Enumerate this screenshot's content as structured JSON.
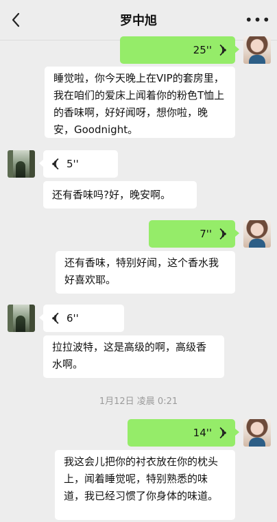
{
  "header": {
    "title": "罗中旭",
    "more_label": "•••"
  },
  "messages": [
    {
      "type": "voice",
      "side": "me",
      "duration": "25''"
    },
    {
      "type": "text",
      "side": "me",
      "text": "睡觉啦，你今天晚上在VIP的套房里，我在咱们的爱床上闻着你的粉色T恤上的香味啊，好好闻呀，想你啦，晚安，Goodnight。"
    },
    {
      "type": "voice",
      "side": "other",
      "duration": "5''"
    },
    {
      "type": "text",
      "side": "other",
      "text": "还有香味吗?好，晚安啊。"
    },
    {
      "type": "voice",
      "side": "me",
      "duration": "7''"
    },
    {
      "type": "text",
      "side": "me",
      "text": "还有香味，特别好闻，这个香水我好喜欢耶。"
    },
    {
      "type": "voice",
      "side": "other",
      "duration": "6''"
    },
    {
      "type": "text",
      "side": "other",
      "text": "拉拉波特，这是高级的啊，高级香水啊。"
    },
    {
      "type": "voice",
      "side": "me",
      "duration": "14''"
    },
    {
      "type": "text",
      "side": "me",
      "text": "我这会儿把你的衬衣放在你的枕头上，闻着睡觉呢，特别熟悉的味道，我已经习惯了你身体的味道。"
    }
  ],
  "timestamp": "1月12日 凌晨 0:21",
  "colors": {
    "background": "#ededed",
    "my_bubble": "#95ec69",
    "other_bubble": "#ffffff"
  },
  "icons": [
    "chevron-left-icon",
    "more-icon",
    "voice-wave-icon",
    "avatar"
  ]
}
